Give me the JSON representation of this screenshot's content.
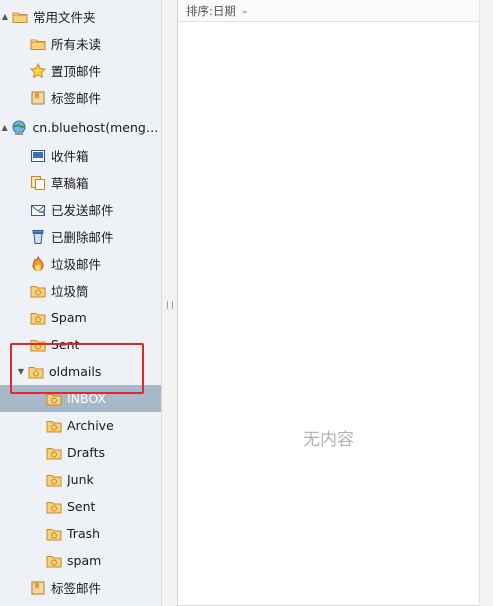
{
  "sidebar": {
    "items": [
      {
        "label": "常用文件夹",
        "icon": "folder-icon",
        "arrow": "▲"
      },
      {
        "label": "所有未读",
        "icon": "folder-icon"
      },
      {
        "label": "置顶邮件",
        "icon": "star-icon"
      },
      {
        "label": "标签邮件",
        "icon": "bookmark-icon"
      },
      {
        "label": "cn.bluehost(mengxi...",
        "icon": "account-globe-icon",
        "arrow": "▲"
      },
      {
        "label": "收件箱",
        "icon": "inbox-icon"
      },
      {
        "label": "草稿箱",
        "icon": "drafts-icon"
      },
      {
        "label": "已发送邮件",
        "icon": "sent-mail-icon"
      },
      {
        "label": "已删除邮件",
        "icon": "trash-icon"
      },
      {
        "label": "垃圾邮件",
        "icon": "junk-fire-icon"
      },
      {
        "label": "垃圾筒",
        "icon": "folder-icon"
      },
      {
        "label": "Spam",
        "icon": "folder-icon"
      },
      {
        "label": "Sent",
        "icon": "folder-icon"
      },
      {
        "label": "oldmails",
        "icon": "folder-icon",
        "arrow": "▼"
      },
      {
        "label": "INBOX",
        "icon": "folder-icon",
        "selected": true
      },
      {
        "label": "Archive",
        "icon": "folder-icon"
      },
      {
        "label": "Drafts",
        "icon": "folder-icon"
      },
      {
        "label": "Junk",
        "icon": "folder-icon"
      },
      {
        "label": "Sent",
        "icon": "folder-icon"
      },
      {
        "label": "Trash",
        "icon": "folder-icon"
      },
      {
        "label": "spam",
        "icon": "folder-icon"
      },
      {
        "label": "标签邮件",
        "icon": "bookmark-icon"
      }
    ]
  },
  "sort": {
    "label": "排序:日期"
  },
  "main": {
    "empty_text": "无内容"
  },
  "colors": {
    "highlight": "#e0272b",
    "selected_bg": "#a8b8c8",
    "folder": "#f0c052"
  }
}
